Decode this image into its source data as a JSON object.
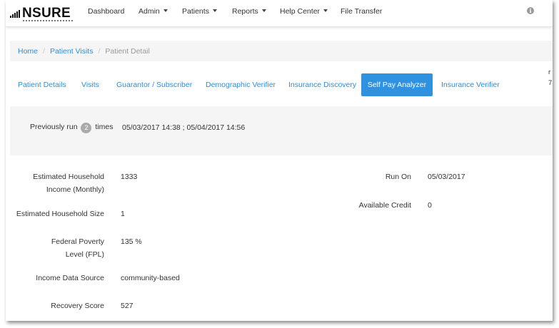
{
  "navbar": {
    "logo_text": "NSURE",
    "items": [
      {
        "label": "Dashboard",
        "dropdown": false
      },
      {
        "label": "Admin",
        "dropdown": true
      },
      {
        "label": "Patients",
        "dropdown": true
      },
      {
        "label": "Reports",
        "dropdown": true
      },
      {
        "label": "Help Center",
        "dropdown": true
      },
      {
        "label": "File Transfer",
        "dropdown": false
      }
    ],
    "info_icon": "info-icon"
  },
  "breadcrumb": {
    "home": "Home",
    "patient_visits": "Patient Visits",
    "current": "Patient Detail"
  },
  "tabs": [
    {
      "label": "Patient Details",
      "active": false
    },
    {
      "label": "Visits",
      "active": false
    },
    {
      "label": "Guarantor / Subscriber",
      "active": false
    },
    {
      "label": "Demographic Verifier",
      "active": false
    },
    {
      "label": "Insurance Discovery",
      "active": false
    },
    {
      "label": "Self Pay Analyzer",
      "active": true
    },
    {
      "label": "Insurance Verifier",
      "active": false
    }
  ],
  "run_info": {
    "prefix": "Previously run",
    "count": "2",
    "suffix": "times",
    "dates": "05/03/2017 14:38 ; 05/04/2017 14:56"
  },
  "fields_left": [
    {
      "label": "Estimated Household Income (Monthly)",
      "value": "1333"
    },
    {
      "label": "Estimated Household Size",
      "value": "1"
    },
    {
      "label": "Federal Poverty Level (FPL)",
      "value": "135 %"
    },
    {
      "label": "Income Data Source",
      "value": "community-based"
    },
    {
      "label": "Recovery Score",
      "value": "527"
    }
  ],
  "fields_right": [
    {
      "label": "Run On",
      "value": "05/03/2017"
    },
    {
      "label": "Available Credit",
      "value": "0"
    }
  ],
  "edge_fragments": [
    "r",
    "7"
  ],
  "colors": {
    "link": "#2d8fd5",
    "active_tab": "#2f92e0",
    "panel_bg": "#f5f5f5",
    "badge": "#aaaaaa"
  }
}
